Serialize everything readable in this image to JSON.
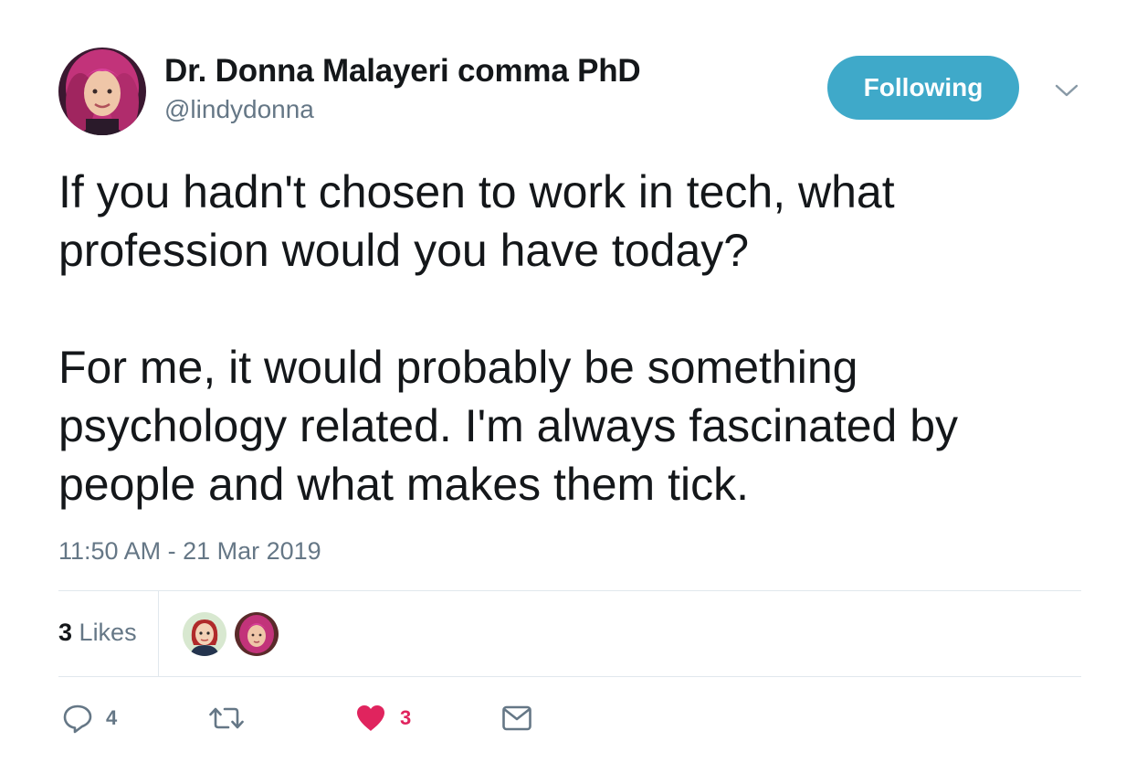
{
  "author": {
    "name": "Dr. Donna Malayeri comma PhD",
    "handle": "@lindydonna",
    "avatar_icon": "avatar-pink-hair"
  },
  "follow_button": {
    "label": "Following",
    "color": "#3fa9c9"
  },
  "menu": {
    "icon": "chevron-down-icon"
  },
  "tweet": {
    "paragraphs": [
      "If you hadn't chosen to work in tech, what profession would you have today?",
      "For me, it would probably be something psychology related. I'm always fascinated by people and what makes them tick."
    ],
    "timestamp": "11:50 AM - 21 Mar 2019"
  },
  "stats": {
    "likes_count": "3",
    "likes_label": "Likes"
  },
  "likers": [
    {
      "icon": "avatar-cartoon-redhead"
    },
    {
      "icon": "avatar-pink-hair"
    }
  ],
  "actions": {
    "reply": {
      "icon": "reply-icon",
      "count": "4"
    },
    "retweet": {
      "icon": "retweet-icon",
      "count": ""
    },
    "like": {
      "icon": "heart-icon",
      "count": "3",
      "color": "#e0245e"
    },
    "message": {
      "icon": "envelope-icon"
    }
  },
  "colors": {
    "text": "#14171a",
    "secondary": "#657786",
    "divider": "#e1e8ed",
    "like": "#e0245e"
  }
}
